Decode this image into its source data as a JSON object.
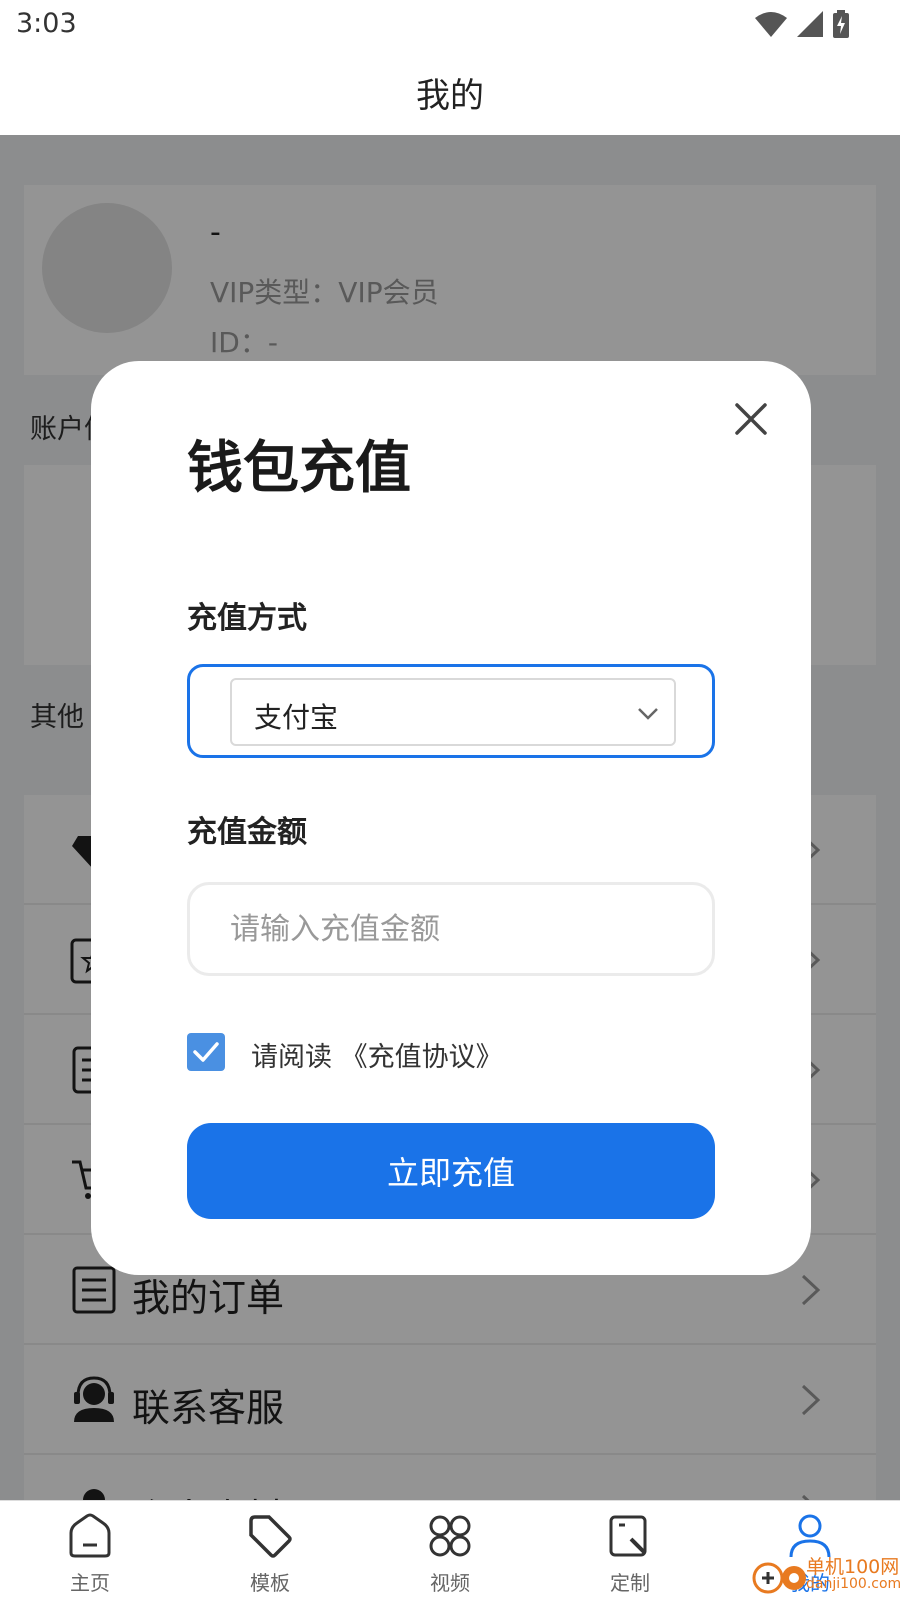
{
  "status_bar": {
    "time": "3:03"
  },
  "header": {
    "title": "我的"
  },
  "profile": {
    "name": "-",
    "vip_type": "VIP类型：VIP会员",
    "id": "ID：-"
  },
  "sections": {
    "account": "账户信息",
    "other": "其他"
  },
  "menu": {
    "items": [
      {
        "label": "",
        "icon": "diamond-icon"
      },
      {
        "label": "",
        "icon": "star-card-icon"
      },
      {
        "label": "",
        "icon": "document-icon"
      },
      {
        "label": "",
        "icon": "cart-icon"
      },
      {
        "label": "我的订单",
        "icon": "order-list-icon"
      },
      {
        "label": "联系客服",
        "icon": "customer-service-icon"
      },
      {
        "label": "个人资料",
        "icon": "person-icon"
      }
    ]
  },
  "tabbar": {
    "items": [
      {
        "label": "主页",
        "icon": "home-icon"
      },
      {
        "label": "模板",
        "icon": "tag-icon"
      },
      {
        "label": "视频",
        "icon": "video-icon"
      },
      {
        "label": "定制",
        "icon": "custom-icon"
      },
      {
        "label": "我的",
        "icon": "user-icon",
        "active": true
      }
    ]
  },
  "dialog": {
    "title": "钱包充值",
    "method_label": "充值方式",
    "method_value": "支付宝",
    "amount_label": "充值金额",
    "amount_placeholder": "请输入充值金额",
    "amount_value": "",
    "agreement_prefix": "请阅读",
    "agreement_link": "《充值协议》",
    "agreement_checked": true,
    "submit_label": "立即充值"
  },
  "watermark": {
    "brand": "单机100网",
    "domain": "danji100.com"
  },
  "colors": {
    "accent": "#1a73e8",
    "checkbox": "#4a90e2",
    "overlay": "rgba(0,0,0,0.42)"
  }
}
